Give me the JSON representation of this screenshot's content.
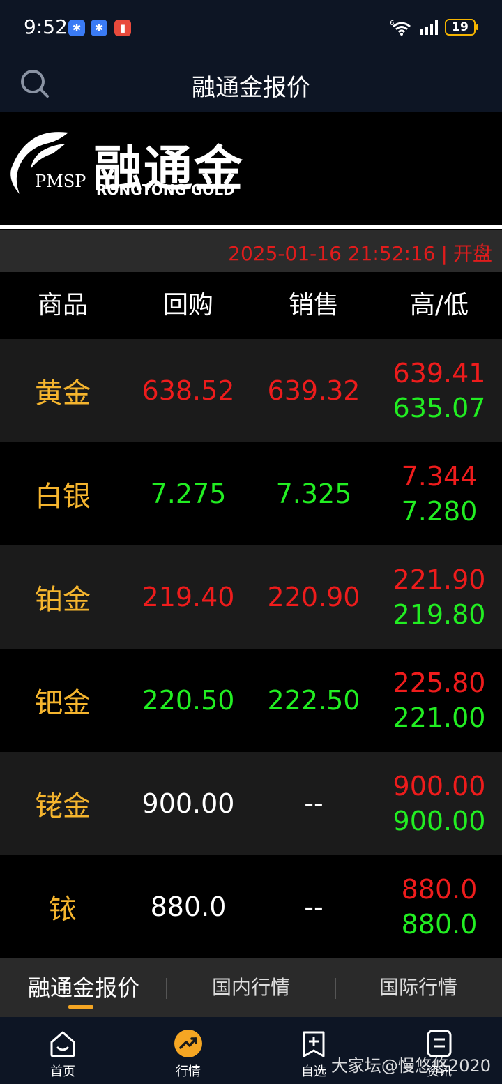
{
  "status": {
    "time": "9:52",
    "battery": "19",
    "network": "6",
    "colors": {
      "app_icon_blue": "#3a7bf5",
      "app_icon_red": "#e84a3c",
      "battery": "#f5b400"
    }
  },
  "header": {
    "title": "融通金报价",
    "search_icon": "search-icon"
  },
  "banner": {
    "brand_cn": "融通金",
    "brand_en": "RONGTONG GOLD",
    "brand_mark": "PMSP"
  },
  "quote_time": {
    "datetime": "2025-01-16 21:52:16",
    "separator": "|",
    "state": "开盘"
  },
  "table": {
    "columns": [
      "商品",
      "回购",
      "销售",
      "高/低"
    ],
    "rows": [
      {
        "name": "黄金",
        "buy": "638.52",
        "buy_color": "red",
        "sell": "639.32",
        "sell_color": "red",
        "high": "639.41",
        "low": "635.07"
      },
      {
        "name": "白银",
        "buy": "7.275",
        "buy_color": "green",
        "sell": "7.325",
        "sell_color": "green",
        "high": "7.344",
        "low": "7.280"
      },
      {
        "name": "铂金",
        "buy": "219.40",
        "buy_color": "red",
        "sell": "220.90",
        "sell_color": "red",
        "high": "221.90",
        "low": "219.80"
      },
      {
        "name": "钯金",
        "buy": "220.50",
        "buy_color": "green",
        "sell": "222.50",
        "sell_color": "green",
        "high": "225.80",
        "low": "221.00"
      },
      {
        "name": "铑金",
        "buy": "900.00",
        "buy_color": "white",
        "sell": "--",
        "sell_color": "white",
        "high": "900.00",
        "low": "900.00"
      },
      {
        "name": "铱",
        "buy": "880.0",
        "buy_color": "white",
        "sell": "--",
        "sell_color": "white",
        "high": "880.0",
        "low": "880.0"
      }
    ],
    "colors": {
      "name": "#f5b52e",
      "up": "#ee1c1c",
      "down": "#22ee22"
    }
  },
  "tabs": [
    {
      "label": "融通金报价",
      "active": true
    },
    {
      "label": "国内行情",
      "active": false
    },
    {
      "label": "国际行情",
      "active": false
    }
  ],
  "bottom_nav": [
    {
      "label": "首页",
      "icon": "home-icon"
    },
    {
      "label": "行情",
      "icon": "market-icon",
      "active": true
    },
    {
      "label": "自选",
      "icon": "watchlist-add-icon"
    },
    {
      "label": "资讯",
      "icon": "news-icon"
    }
  ],
  "watermark": "大家坛@慢悠悠2020"
}
